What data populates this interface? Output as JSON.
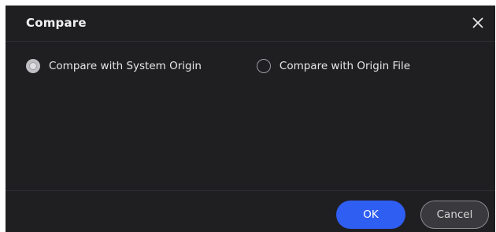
{
  "dialog": {
    "title": "Compare",
    "close_icon": "close-icon"
  },
  "options": [
    {
      "label": "Compare with System Origin",
      "selected": true
    },
    {
      "label": "Compare with Origin File",
      "selected": false
    }
  ],
  "footer": {
    "ok_label": "OK",
    "cancel_label": "Cancel"
  },
  "colors": {
    "background": "#1f1f22",
    "primary": "#2f5ef2",
    "secondary_button": "#3a3a3e",
    "divider": "#303034"
  }
}
